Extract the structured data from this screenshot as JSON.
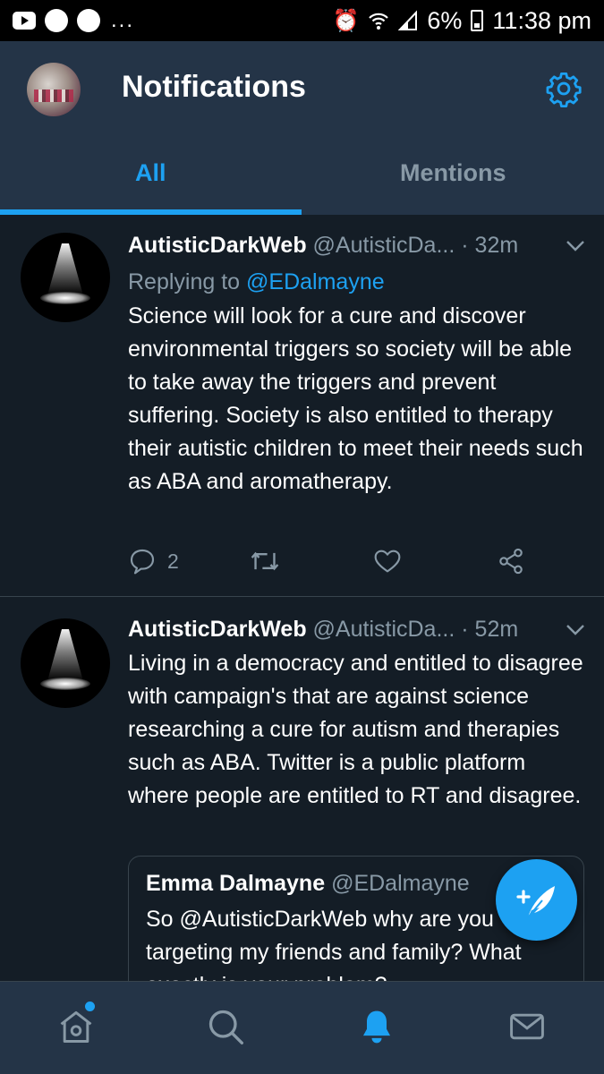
{
  "status_bar": {
    "time": "11:38 pm",
    "battery": "6%",
    "overflow": "..."
  },
  "header": {
    "title": "Notifications"
  },
  "tabs": [
    {
      "label": "All",
      "active": true
    },
    {
      "label": "Mentions",
      "active": false
    }
  ],
  "tweets": [
    {
      "name": "AutisticDarkWeb",
      "handle": "@AutisticDa...",
      "time": "· 32m",
      "reply_prefix": "Replying to ",
      "reply_to": "@EDalmayne",
      "text": "Science will look for a cure and discover environmental triggers so society will be able to take away the triggers and prevent suffering. Society is also entitled to therapy their autistic children to meet their needs such as ABA and aromatherapy.",
      "reply_count": "2"
    },
    {
      "name": "AutisticDarkWeb",
      "handle": "@AutisticDa...",
      "time": "· 52m",
      "text": "Living in a democracy and entitled to disagree with campaign's that are against science researching a cure for autism and therapies such as ABA. Twitter is a public platform where people are entitled to RT and disagree.",
      "quote": {
        "name": "Emma Dalmayne",
        "handle": "@EDalmayne",
        "text": "So @AutisticDarkWeb why are you targeting my friends and family? What exactly is your problem?"
      }
    }
  ],
  "colors": {
    "background": "#141d26",
    "bar": "#243447",
    "accent": "#1da1f2",
    "muted": "#8899a6",
    "divider": "#38444d"
  },
  "icons": {
    "header": "gear-icon",
    "fab": "compose-tweet-icon",
    "nav": [
      "home-icon",
      "search-icon",
      "bell-icon",
      "mail-icon"
    ],
    "actions": [
      "reply-icon",
      "retweet-icon",
      "like-icon",
      "share-icon"
    ]
  }
}
